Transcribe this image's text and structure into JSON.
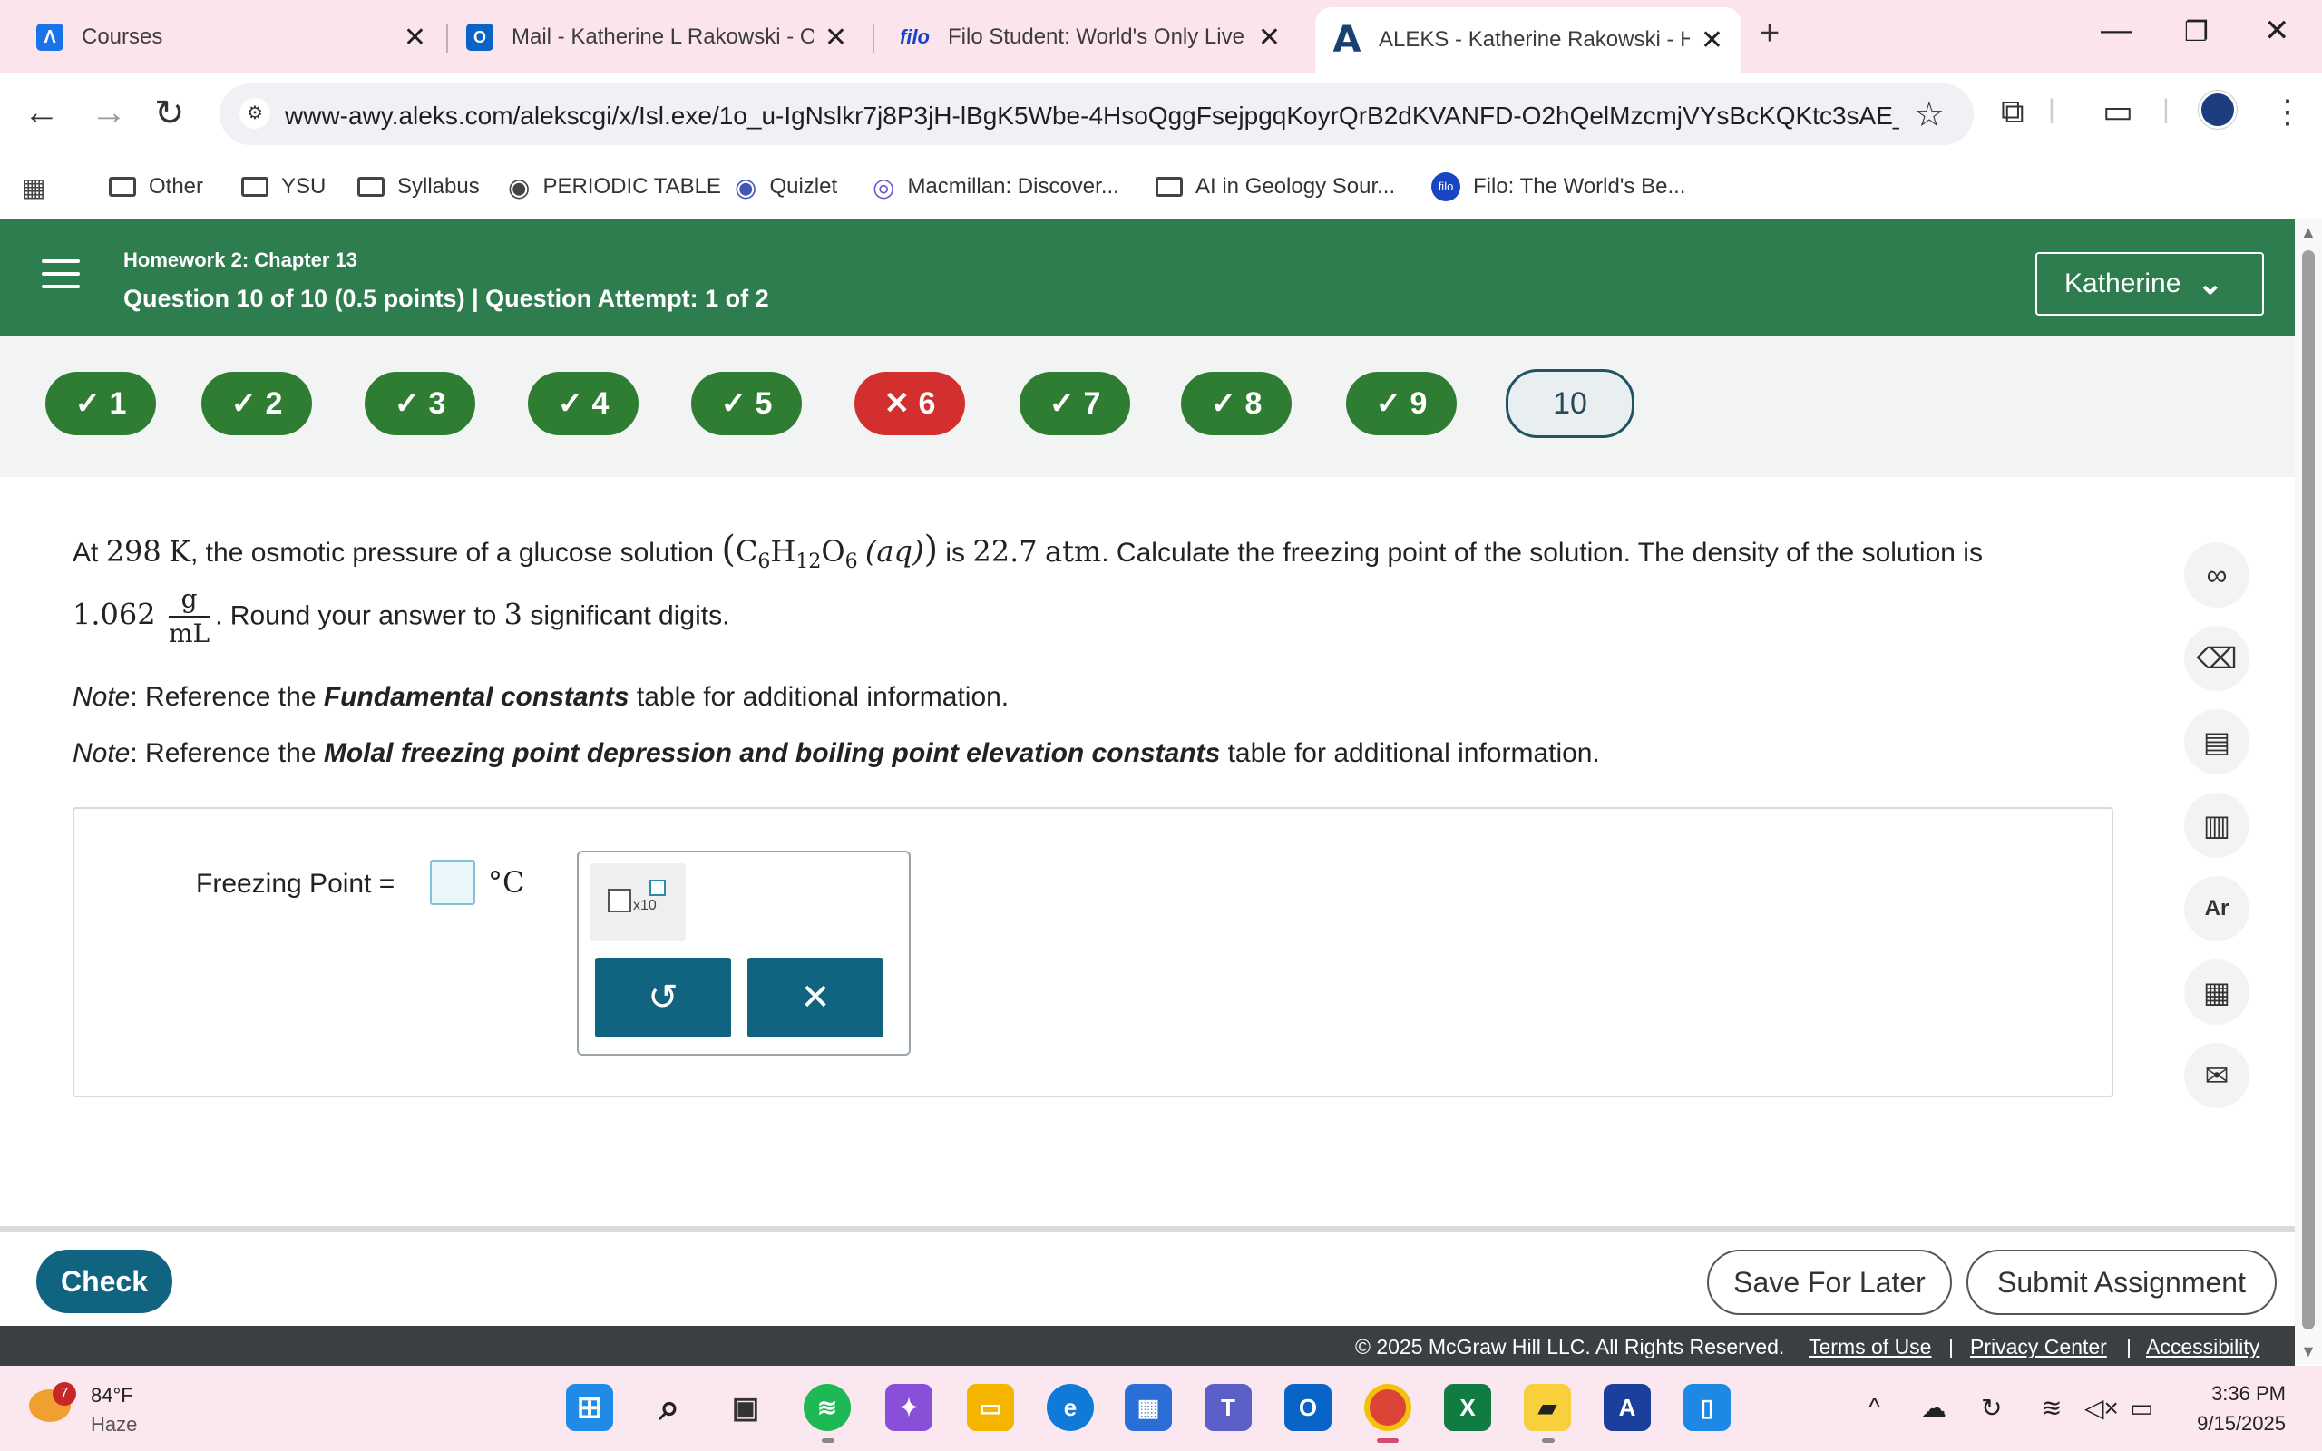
{
  "browser": {
    "tabs": [
      {
        "title": "Courses",
        "favicon": "aleks-icon"
      },
      {
        "title": "Mail - Katherine L Rakowski - O",
        "favicon": "outlook-icon"
      },
      {
        "title": "Filo Student: World's Only Live I",
        "favicon": "filo-icon",
        "favicon_text": "filo"
      },
      {
        "title": "ALEKS - Katherine Rakowski - H",
        "favicon": "aleks-icon",
        "active": true
      }
    ],
    "url": "www-awy.aleks.com/alekscgi/x/Isl.exe/1o_u-IgNslkr7j8P3jH-lBgK5Wbe-4HsoQggFsejpgqKoyrQrB2dKVANFD-O2hQelMzcmjVYsBcKQKtc3sAE_...",
    "bookmarks": [
      {
        "label": "Other",
        "icon": "folder-icon"
      },
      {
        "label": "YSU",
        "icon": "folder-icon"
      },
      {
        "label": "Syllabus",
        "icon": "folder-icon"
      },
      {
        "label": "PERIODIC TABLE",
        "icon": "globe-icon"
      },
      {
        "label": "Quizlet",
        "icon": "quizlet-icon"
      },
      {
        "label": "Macmillan: Discover...",
        "icon": "macmillan-icon"
      },
      {
        "label": "AI in Geology Sour...",
        "icon": "folder-icon"
      },
      {
        "label": "Filo: The World's Be...",
        "icon": "filo-icon",
        "icon_text": "filo"
      }
    ]
  },
  "header": {
    "homework_title": "Homework 2: Chapter 13",
    "question_info": "Question 10 of 10 (0.5 points)  |  Question Attempt: 1 of 2",
    "user_name": "Katherine",
    "color": "#2e7d4f"
  },
  "question_nav": [
    {
      "label": "✓ 1",
      "status": "correct"
    },
    {
      "label": "✓ 2",
      "status": "correct"
    },
    {
      "label": "✓ 3",
      "status": "correct"
    },
    {
      "label": "✓ 4",
      "status": "correct"
    },
    {
      "label": "✓ 5",
      "status": "correct"
    },
    {
      "label": "✕ 6",
      "status": "incorrect"
    },
    {
      "label": "✓ 7",
      "status": "correct"
    },
    {
      "label": "✓ 8",
      "status": "correct"
    },
    {
      "label": "✓ 9",
      "status": "correct"
    },
    {
      "label": "10",
      "status": "current"
    }
  ],
  "question": {
    "p1_a": "At ",
    "temp_val": "298",
    "temp_unit": "K",
    "p1_b": ", the osmotic pressure of a glucose solution ",
    "formula_c": "C",
    "formula_c_sub": "6",
    "formula_h": "H",
    "formula_h_sub": "12",
    "formula_o": "O",
    "formula_o_sub": "6",
    "formula_state": "(aq)",
    "p1_c": " is ",
    "pressure_val": "22.7",
    "pressure_unit": "atm",
    "p1_d": ". Calculate the freezing point of the solution. The density of the solution is",
    "density_val": "1.062",
    "density_num": "g",
    "density_den": "mL",
    "p2_a": ". Round your answer to ",
    "sig_digits": "3",
    "p2_b": " significant digits.",
    "note_prefix": "Note",
    "note1_a": ": Reference the ",
    "note1_bold": "Fundamental constants",
    "note1_b": " table for additional information.",
    "note2_a": ": Reference the ",
    "note2_bold": "Molal freezing point depression and boiling point elevation constants",
    "note2_b": " table for additional information."
  },
  "answer": {
    "label": "Freezing Point  =",
    "value": "",
    "unit": "°C",
    "sci_label": "x10",
    "undo_icon": "↺",
    "clear_icon": "✕"
  },
  "side_tools": [
    "glasses-icon",
    "eraser-icon",
    "notes-icon",
    "chart-icon",
    "periodic-table-icon",
    "calculator-icon",
    "mail-icon"
  ],
  "bottom": {
    "check": "Check",
    "save": "Save For Later",
    "submit": "Submit Assignment"
  },
  "footer": {
    "copyright": "© 2025 McGraw Hill LLC. All Rights Reserved.",
    "terms": "Terms of Use",
    "privacy": "Privacy Center",
    "accessibility": "Accessibility"
  },
  "taskbar": {
    "weather_badge": "7",
    "temp": "84°F",
    "condition": "Haze",
    "time": "3:36 PM",
    "date": "9/15/2025"
  }
}
